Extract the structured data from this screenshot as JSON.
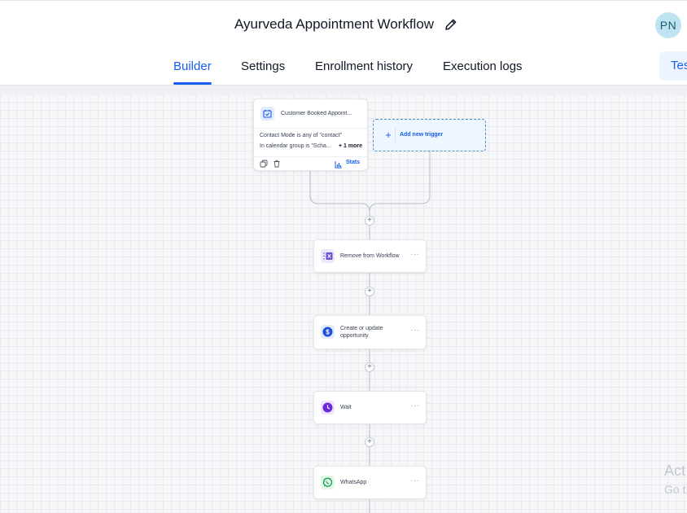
{
  "header": {
    "title": "Ayurveda Appointment Workflow",
    "edit_icon": "pencil-icon",
    "avatar_initials": "PN"
  },
  "tabs": [
    {
      "label": "Builder",
      "active": true
    },
    {
      "label": "Settings",
      "active": false
    },
    {
      "label": "Enrollment history",
      "active": false
    },
    {
      "label": "Execution logs",
      "active": false
    }
  ],
  "test_button": {
    "label": "Tes"
  },
  "colors": {
    "accent": "#155eef",
    "canvas": "#f6f7f9",
    "avatar_bg": "#bfe4f1"
  },
  "trigger": {
    "title": "Customer Booked Appoint...",
    "icon": "calendar-check-icon",
    "conditions": [
      "Contact Mode is any of \"contact\"",
      "In calendar group is \"Scha..."
    ],
    "more_label": "+ 1 more",
    "stats_label": "Stats",
    "copy_icon": "copy-icon",
    "delete_icon": "trash-icon"
  },
  "add_trigger": {
    "label": "Add new trigger",
    "icon": "plus-icon"
  },
  "add_step_icon": "plus-icon",
  "actions": [
    {
      "label": "Remove from Workflow",
      "icon": "remove-workflow-icon",
      "menu": "···"
    },
    {
      "label": "Create or update opportunity",
      "icon": "dollar-icon",
      "menu": "···"
    },
    {
      "label": "Wait",
      "icon": "clock-icon",
      "menu": "···"
    },
    {
      "label": "WhatsApp",
      "icon": "whatsapp-icon",
      "menu": "···"
    }
  ],
  "watermark": {
    "line1": "Act",
    "line2": "Go t"
  }
}
